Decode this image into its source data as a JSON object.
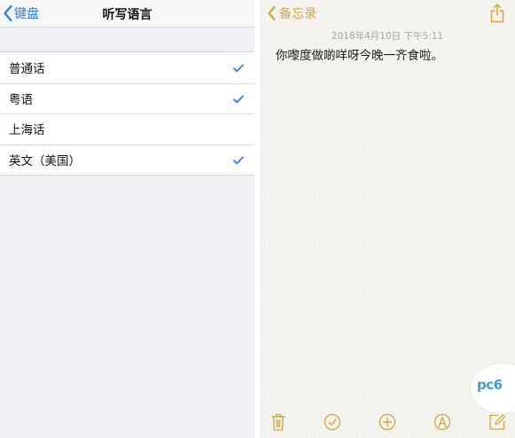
{
  "left_nav": {
    "back_label": "键盘",
    "title": "听写语言"
  },
  "languages": [
    {
      "label": "普通话",
      "checked": true
    },
    {
      "label": "粤语",
      "checked": true
    },
    {
      "label": "上海话",
      "checked": false
    },
    {
      "label": "英文（美国）",
      "checked": true
    }
  ],
  "notes": {
    "back_label": "备忘录",
    "date": "2018年4月10日 下午5:11",
    "body": "你嚟度做啲咩呀今晚一齐食啦。",
    "watermark": "pc6"
  },
  "toolbar": {
    "icons": [
      "trash-icon",
      "checklist-icon",
      "add-icon",
      "sketch-icon",
      "compose-icon"
    ]
  },
  "colors": {
    "ios_blue": "#2f7bf5",
    "notes_gold": "#d7a53a",
    "check_blue": "#2f7bf5"
  }
}
